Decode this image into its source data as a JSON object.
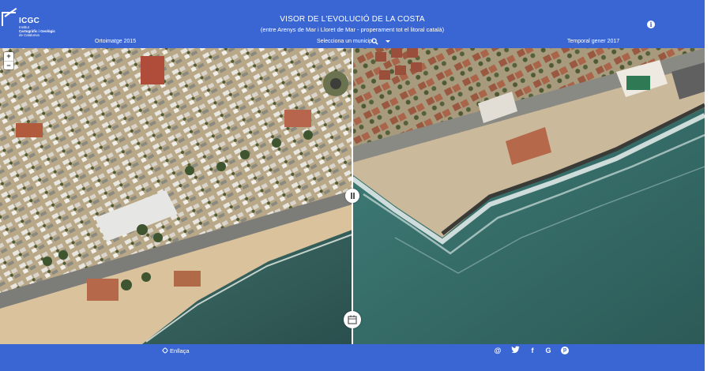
{
  "header": {
    "logo_name": "ICGC",
    "logo_sub_1": "Institut",
    "logo_sub_2": "Cartogràfic i Geològic",
    "logo_sub_3": "de Catalunya",
    "title": "VISOR DE L'EVOLUCIÓ DE LA COSTA",
    "subtitle": "(entre Arenys de Mar i Lloret de Mar - properament tot el litoral català)",
    "info_icon": "info-icon"
  },
  "toolbar": {
    "left_layer": "Ortoimatge 2015",
    "municipality_select": "Selecciona un municipi",
    "right_layer": "Temporal gener 2017"
  },
  "map": {
    "zoom_in": "+",
    "zoom_out": "−",
    "divider_handle_icon": "drag-handle-icon",
    "calendar_icon": "calendar-icon"
  },
  "footer": {
    "link_label": "Enllaça",
    "social": [
      "@",
      "twitter",
      "f",
      "G",
      "p"
    ]
  },
  "colors": {
    "brand_blue": "#3a66d4",
    "sea": "#2d5a52",
    "sand": "#d8c3a0"
  }
}
